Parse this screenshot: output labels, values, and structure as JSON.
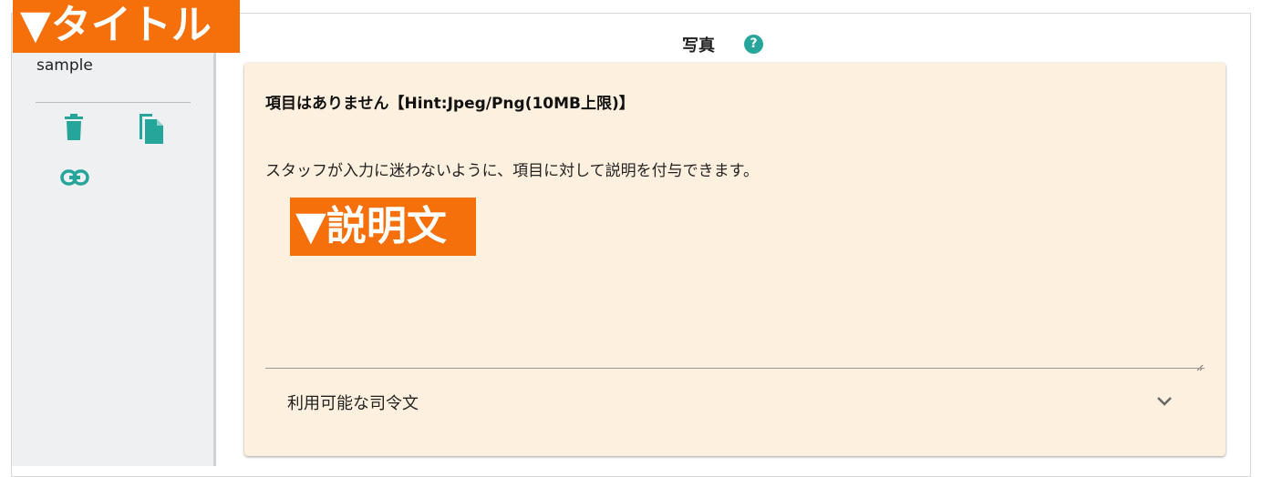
{
  "overlays": {
    "title_tag": "▼タイトル",
    "description_tag": "▼説明文"
  },
  "sidebar": {
    "item_name": "sample",
    "icons": [
      "delete-icon",
      "copy-icon",
      "link-icon"
    ],
    "accent_color": "#26a59a"
  },
  "header": {
    "title": "写真",
    "help_glyph": "?"
  },
  "card": {
    "label": "項目はありません【Hint:Jpeg/Png(10MB上限)】",
    "description": "スタッフが入力に迷わないように、項目に対して説明を付与できます。",
    "expander_label": "利用可能な司令文",
    "background_color": "#fdf0de"
  }
}
